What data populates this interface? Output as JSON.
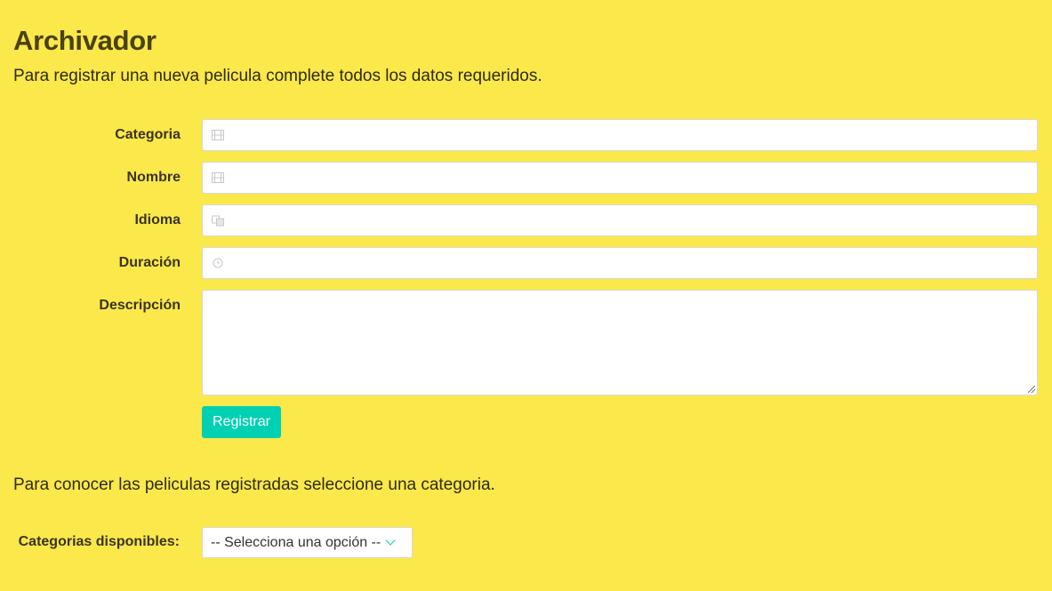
{
  "header": {
    "title": "Archivador",
    "intro": "Para registrar una nueva pelicula complete todos los datos requeridos."
  },
  "form": {
    "fields": [
      {
        "label": "Categoria",
        "icon": "film-icon",
        "value": "",
        "placeholder": ""
      },
      {
        "label": "Nombre",
        "icon": "film-icon",
        "value": "",
        "placeholder": ""
      },
      {
        "label": "Idioma",
        "icon": "language-icon",
        "value": "",
        "placeholder": ""
      },
      {
        "label": "Duración",
        "icon": "clock-icon",
        "value": "",
        "placeholder": ""
      }
    ],
    "description_label": "Descripción",
    "description_value": "",
    "submit_label": "Registrar"
  },
  "lookup": {
    "intro": "Para conocer las peliculas registradas seleccione una categoria.",
    "select_label": "Categorias disponibles:",
    "select_value": "-- Selecciona una opción --"
  },
  "colors": {
    "background": "#fbe84a",
    "accent": "#00d1b2",
    "title": "#4a4210"
  }
}
